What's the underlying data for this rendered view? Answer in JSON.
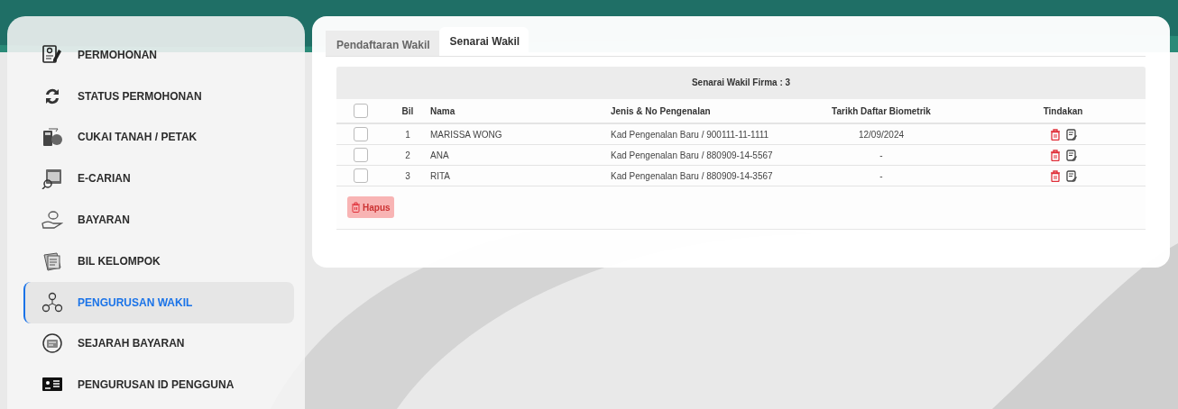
{
  "sidebar": {
    "items": [
      {
        "label": "PERMOHONAN",
        "selected": false
      },
      {
        "label": "STATUS PERMOHONAN",
        "selected": false
      },
      {
        "label": "CUKAI TANAH / PETAK",
        "selected": false
      },
      {
        "label": "E-CARIAN",
        "selected": false
      },
      {
        "label": "BAYARAN",
        "selected": false
      },
      {
        "label": "BIL KELOMPOK",
        "selected": false
      },
      {
        "label": "PENGURUSAN WAKIL",
        "selected": true
      },
      {
        "label": "SEJARAH BAYARAN",
        "selected": false
      },
      {
        "label": "PENGURUSAN ID PENGGUNA",
        "selected": false
      }
    ]
  },
  "tabs": [
    {
      "label": "Pendaftaran Wakil",
      "selected": false
    },
    {
      "label": "Senarai Wakil",
      "selected": true
    }
  ],
  "table": {
    "title": "Senarai Wakil Firma : 3",
    "select_all_checked": false,
    "columns": [
      "Bil",
      "Nama",
      "Jenis & No Pengenalan",
      "Tarikh Daftar Biometrik",
      "Tindakan"
    ],
    "rows": [
      {
        "checked": false,
        "bil": "1",
        "nama": "MARISSA WONG",
        "pengenalan": "Kad Pengenalan Baru / 900111-11-1111",
        "tarikh": "12/09/2024"
      },
      {
        "checked": false,
        "bil": "2",
        "nama": "ANA",
        "pengenalan": "Kad Pengenalan Baru / 880909-14-5567",
        "tarikh": "-"
      },
      {
        "checked": false,
        "bil": "3",
        "nama": "RITA",
        "pengenalan": "Kad Pengenalan Baru / 880909-14-3567",
        "tarikh": "-"
      }
    ]
  },
  "delete_button": "Hapus"
}
